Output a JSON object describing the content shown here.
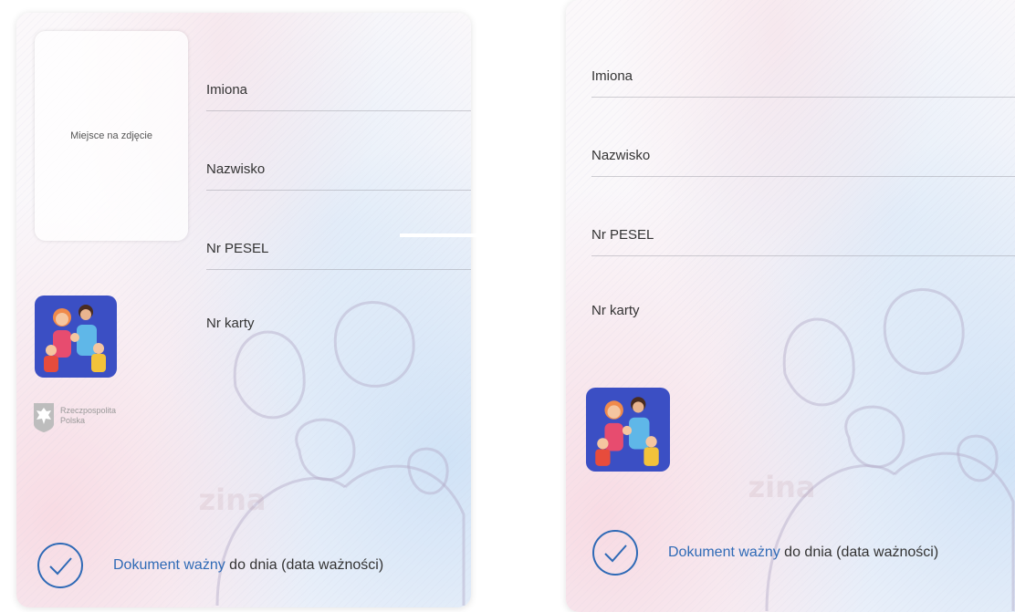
{
  "left_card": {
    "photo_placeholder": "Miejsce na zdjęcie",
    "fields": {
      "first_names": "Imiona",
      "surname": "Nazwisko",
      "pesel": "Nr PESEL",
      "card_number": "Nr karty"
    },
    "issuer": {
      "line1": "Rzeczpospolita",
      "line2": "Polska"
    },
    "validity": {
      "strong": "Dokument ważny",
      "rest": "do dnia (data ważności)"
    }
  },
  "right_card": {
    "fields": {
      "first_names": "Imiona",
      "surname": "Nazwisko",
      "pesel": "Nr PESEL",
      "card_number": "Nr karty"
    },
    "validity": {
      "strong": "Dokument ważny",
      "rest": "do dnia (data ważności)"
    }
  },
  "colors": {
    "accent": "#2f6ab6",
    "emblem_bg": "#3b4fc4"
  },
  "icons": [
    "check-circle-icon",
    "eagle-emblem-icon",
    "family-emblem-icon"
  ]
}
